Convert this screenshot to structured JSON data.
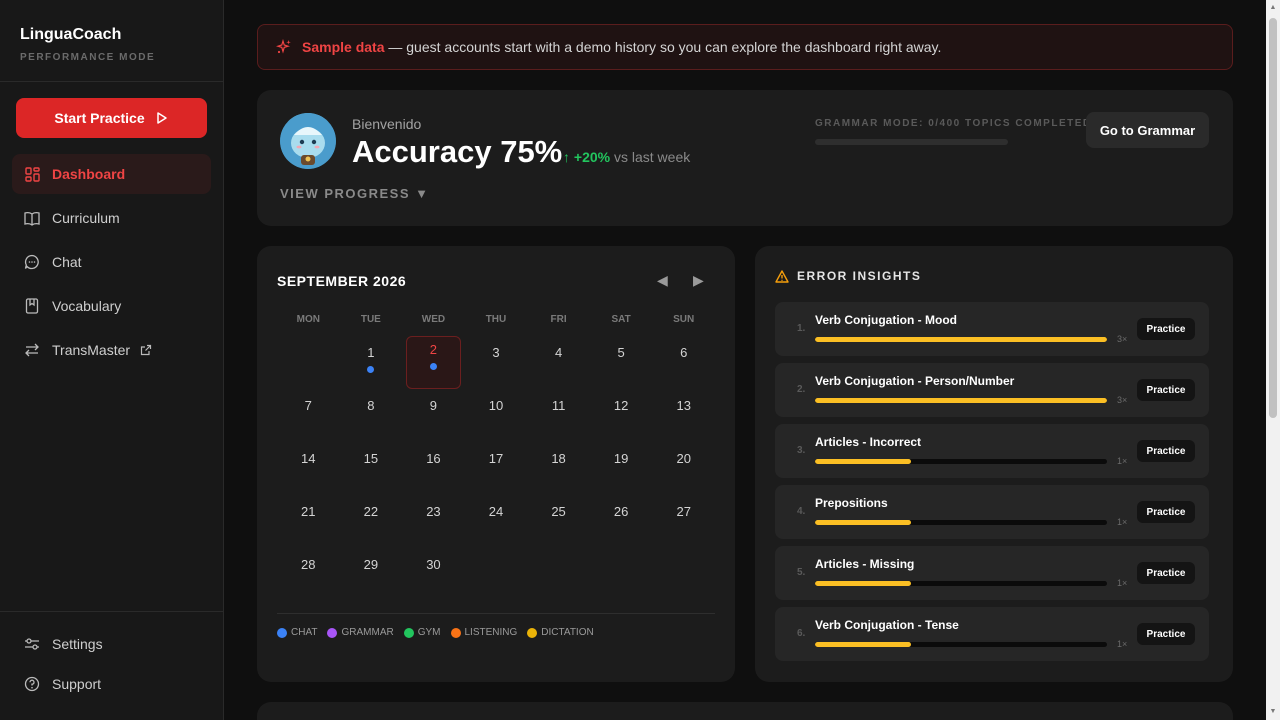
{
  "brand": {
    "name": "LinguaCoach",
    "mode": "PERFORMANCE MODE"
  },
  "sidebar": {
    "start_label": "Start Practice",
    "items": [
      {
        "label": "Dashboard",
        "icon": "grid-icon",
        "active": true
      },
      {
        "label": "Curriculum",
        "icon": "book-icon"
      },
      {
        "label": "Chat",
        "icon": "chat-bubble-icon"
      },
      {
        "label": "Vocabulary",
        "icon": "bookmark-book-icon"
      },
      {
        "label": "TransMaster",
        "icon": "swap-arrows-icon",
        "external": true
      }
    ],
    "bottom": [
      {
        "label": "Settings",
        "icon": "sliders-icon"
      },
      {
        "label": "Support",
        "icon": "help-circle-icon"
      }
    ]
  },
  "banner": {
    "highlight": "Sample data",
    "text": " — guest accounts start with a demo history so you can explore the dashboard right away."
  },
  "hero": {
    "greeting": "Bienvenido",
    "accuracy": "Accuracy 75%",
    "delta_value": "↑ +20%",
    "delta_suffix": " vs last week",
    "view_progress": "VIEW PROGRESS ▼",
    "grammar_mode": "GRAMMAR MODE: 0/400 TOPICS COMPLETED",
    "grammar_progress": 0,
    "grammar_button": "Go to Grammar"
  },
  "calendar": {
    "title": "SEPTEMBER 2026",
    "weekdays": [
      "MON",
      "TUE",
      "WED",
      "THU",
      "FRI",
      "SAT",
      "SUN"
    ],
    "leading_blanks": 1,
    "days": 30,
    "today": 2,
    "activity_days": [
      1,
      2
    ],
    "legend": [
      {
        "label": "CHAT",
        "color": "#3b82f6"
      },
      {
        "label": "GRAMMAR",
        "color": "#a855f7"
      },
      {
        "label": "GYM",
        "color": "#22c55e"
      },
      {
        "label": "LISTENING",
        "color": "#f97316"
      },
      {
        "label": "DICTATION",
        "color": "#eab308"
      }
    ]
  },
  "insights": {
    "title": "ERROR INSIGHTS",
    "practice_label": "Practice",
    "items": [
      {
        "rank": "1.",
        "name": "Verb Conjugation - Mood",
        "count": "3×",
        "level": 1.0
      },
      {
        "rank": "2.",
        "name": "Verb Conjugation - Person/Number",
        "count": "3×",
        "level": 1.0
      },
      {
        "rank": "3.",
        "name": "Articles - Incorrect",
        "count": "1×",
        "level": 0.33
      },
      {
        "rank": "4.",
        "name": "Prepositions",
        "count": "1×",
        "level": 0.33
      },
      {
        "rank": "5.",
        "name": "Articles - Missing",
        "count": "1×",
        "level": 0.33
      },
      {
        "rank": "6.",
        "name": "Verb Conjugation - Tense",
        "count": "1×",
        "level": 0.33
      }
    ]
  },
  "colors": {
    "accent": "#dc2626",
    "bar": "#fbbf24",
    "positive": "#22c55e"
  }
}
